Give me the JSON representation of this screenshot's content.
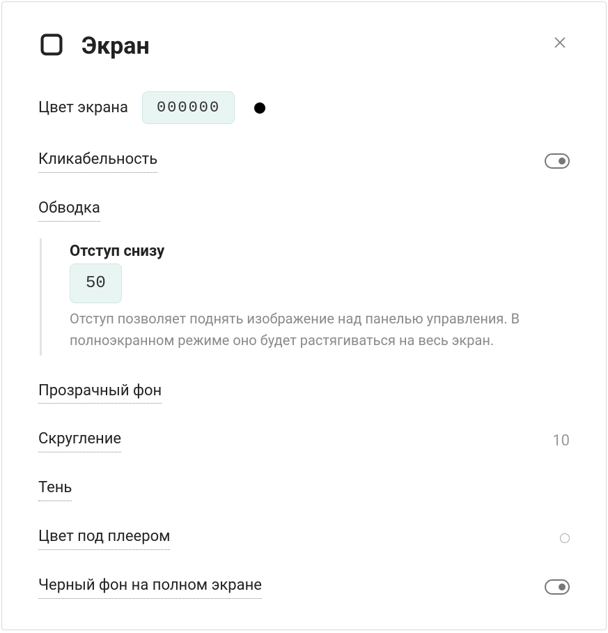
{
  "header": {
    "title": "Экран"
  },
  "screen_color": {
    "label": "Цвет экрана",
    "value": "000000",
    "swatch": "#000000"
  },
  "clickability": {
    "label": "Кликабельность",
    "toggle": "on"
  },
  "outline": {
    "label": "Обводка"
  },
  "bottom_offset": {
    "title": "Отступ снизу",
    "value": "50",
    "help": "Отступ позволяет поднять изображение над панелью управления. В полноэкранном режиме оно будет растягиваться на весь экран."
  },
  "transparent_bg": {
    "label": "Прозрачный фон"
  },
  "rounding": {
    "label": "Скругление",
    "value": "10"
  },
  "shadow": {
    "label": "Тень"
  },
  "color_under_player": {
    "label": "Цвет под плеером"
  },
  "black_fullscreen": {
    "label": "Черный фон на полном экране",
    "toggle": "on"
  }
}
